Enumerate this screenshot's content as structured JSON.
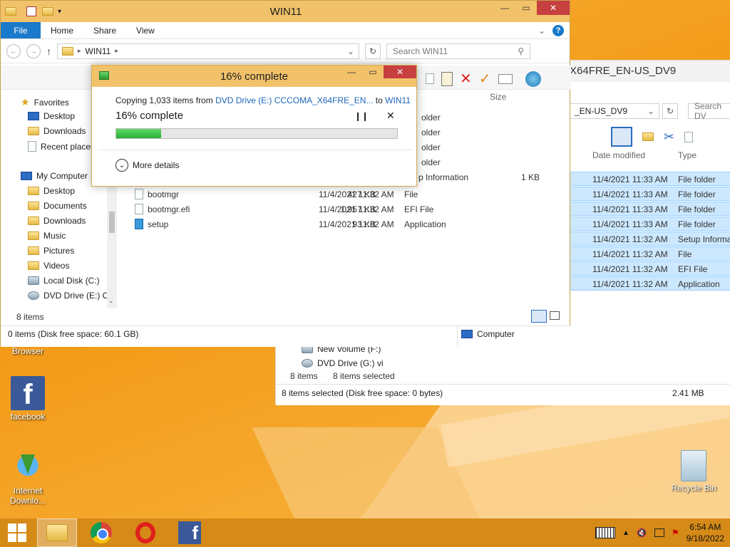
{
  "desktop": {
    "icons": [
      {
        "name": "browser",
        "label": "Browser"
      },
      {
        "name": "facebook",
        "label": "facebook"
      },
      {
        "name": "internet-download-manager",
        "label": "Internet Downlo..."
      },
      {
        "name": "recycle-bin",
        "label": "Recycle Bin"
      }
    ]
  },
  "win_back": {
    "title_partial": "X64FRE_EN-US_DV9",
    "addr_partial": "_EN-US_DV9",
    "search": "Search DV",
    "cols": {
      "date": "Date modified",
      "type": "Type"
    },
    "rows": [
      {
        "date": "11/4/2021 11:33 AM",
        "type": "File folder"
      },
      {
        "date": "11/4/2021 11:33 AM",
        "type": "File folder"
      },
      {
        "date": "11/4/2021 11:33 AM",
        "type": "File folder"
      },
      {
        "date": "11/4/2021 11:33 AM",
        "type": "File folder"
      },
      {
        "date": "11/4/2021 11:32 AM",
        "type": "Setup Informa"
      },
      {
        "date": "11/4/2021 11:32 AM",
        "type": "File"
      },
      {
        "date": "11/4/2021 11:32 AM",
        "type": "EFI File"
      },
      {
        "date": "11/4/2021 11:32 AM",
        "type": "Application"
      }
    ],
    "nav": [
      {
        "label": "New Volume (F:)"
      },
      {
        "label": "DVD Drive (G:) vi"
      }
    ],
    "count": "8 items",
    "selected": "8 items selected",
    "status": "8 items selected (Disk free space: 0 bytes)",
    "size": "2.41 MB"
  },
  "win_main": {
    "title": "WIN11",
    "tabs": {
      "file": "File",
      "home": "Home",
      "share": "Share",
      "view": "View"
    },
    "address": "WIN11",
    "search_placeholder": "Search WIN11",
    "size_col": "Size",
    "nav": {
      "favorites": "Favorites",
      "desktop": "Desktop",
      "downloads": "Downloads",
      "recent": "Recent places",
      "mycomputer": "My Computer",
      "desktop2": "Desktop",
      "documents": "Documents",
      "downloads2": "Downloads",
      "music": "Music",
      "pictures": "Pictures",
      "videos": "Videos",
      "local": "Local Disk (C:)",
      "dvd": "DVD Drive (E:) CC"
    },
    "partial_types": [
      "older",
      "older",
      "older",
      "older",
      "p Information"
    ],
    "partial_size": "1 KB",
    "files": [
      {
        "name": "bootmgr",
        "date": "11/4/2021 11:32 AM",
        "type": "File",
        "size": "427 KB"
      },
      {
        "name": "bootmgr.efi",
        "date": "11/4/2021 11:32 AM",
        "type": "EFI File",
        "size": "1,957 KB"
      },
      {
        "name": "setup",
        "date": "11/4/2021 11:32 AM",
        "type": "Application",
        "size": "93 KB"
      }
    ],
    "count": "8 items",
    "status": "0 items (Disk free space: 60.1 GB)",
    "status_right": "Computer"
  },
  "dialog": {
    "title": "16% complete",
    "copy_prefix": "Copying 1,033 items from",
    "source": "DVD Drive (E:) CCCOMA_X64FRE_EN...",
    "to": "to",
    "dest": "WIN11",
    "status": "16% complete",
    "progress": 0.16,
    "more_details": "More details"
  },
  "taskbar": {
    "time": "6:54 AM",
    "date": "9/18/2022"
  }
}
